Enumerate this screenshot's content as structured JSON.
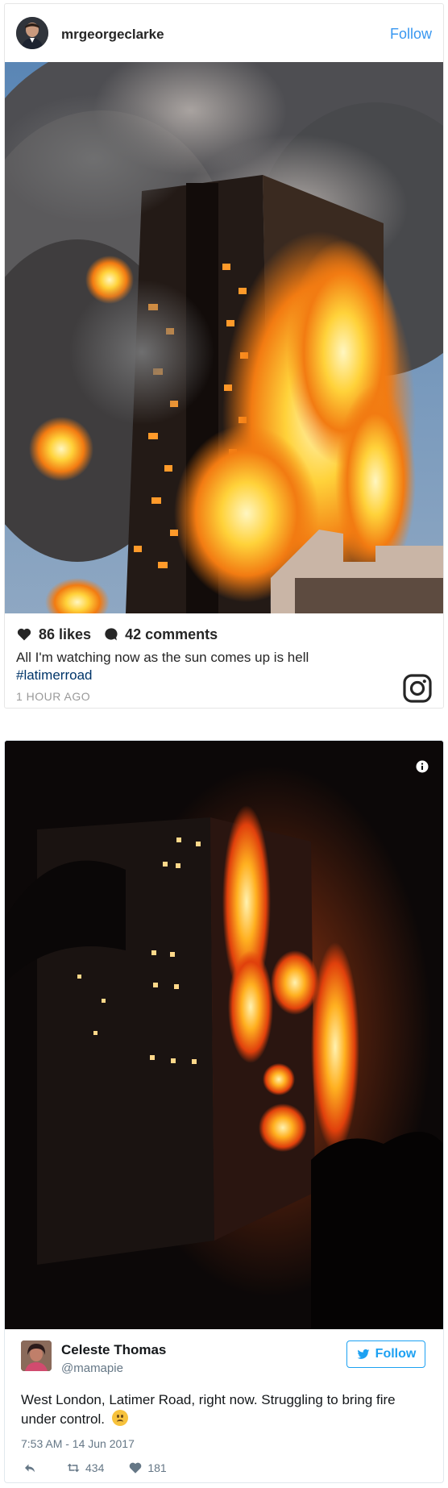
{
  "instagram": {
    "username": "mrgeorgeclarke",
    "follow_label": "Follow",
    "likes": "86 likes",
    "comments": "42 comments",
    "caption": "All I'm watching now as the sun comes up is hell",
    "hashtag": "#latimerroad",
    "time": "1 HOUR AGO",
    "icons": [
      "heart-icon",
      "comment-icon",
      "instagram-logo-icon"
    ],
    "colors": {
      "follow": "#3897f0",
      "hashtag": "#003569",
      "time": "#999999"
    }
  },
  "twitter": {
    "name": "Celeste Thomas",
    "handle": "@mamapie",
    "follow_label": "Follow",
    "text": "West London, Latimer Road, right now. Struggling to bring fire under control.",
    "timestamp": "7:53 AM - 14 Jun 2017",
    "retweets": "434",
    "likes": "181",
    "icons": [
      "info-icon",
      "twitter-bird-icon",
      "reply-icon",
      "retweet-icon",
      "heart-icon",
      "frowning-face-emoji"
    ],
    "colors": {
      "accent": "#1da1f2",
      "muted": "#657786"
    }
  }
}
